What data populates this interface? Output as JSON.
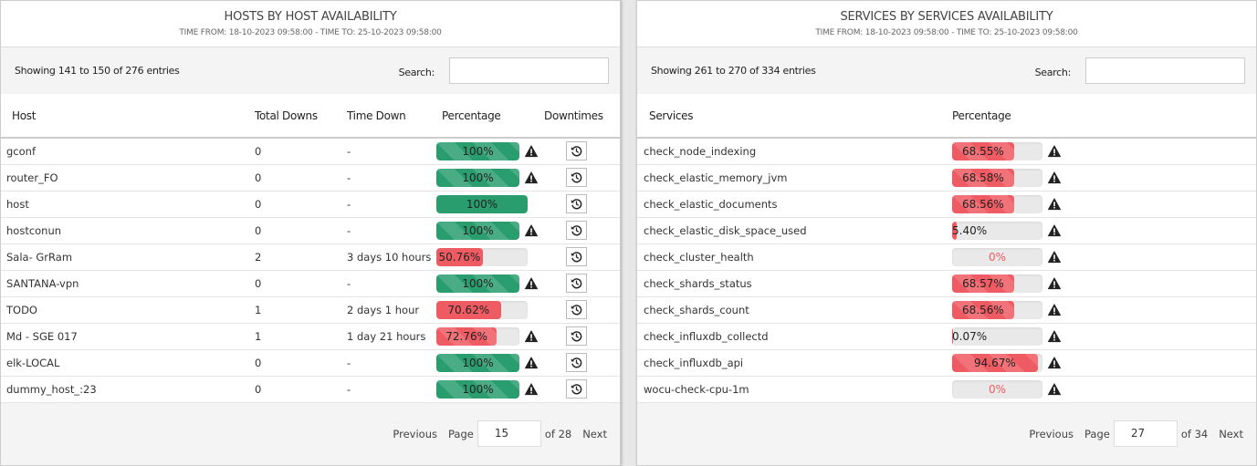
{
  "hosts_panel": {
    "title": "HOSTS BY HOST AVAILABILITY",
    "subtitle": "TIME FROM: 18-10-2023 09:58:00 - TIME TO: 25-10-2023 09:58:00",
    "info": "Showing 141 to 150 of 276 entries",
    "search_label": "Search:",
    "search_value": "",
    "columns": [
      "Host",
      "Total Downs",
      "Time Down",
      "Percentage",
      "Downtimes"
    ],
    "rows": [
      {
        "host": "gconf",
        "total_downs": "0",
        "time_down": "-",
        "percentage": 100,
        "label": "100%",
        "color": "green",
        "striped": true,
        "warning": true
      },
      {
        "host": "router_FO",
        "total_downs": "0",
        "time_down": "-",
        "percentage": 100,
        "label": "100%",
        "color": "green",
        "striped": true,
        "warning": true
      },
      {
        "host": "host",
        "total_downs": "0",
        "time_down": "-",
        "percentage": 100,
        "label": "100%",
        "color": "green",
        "striped": false,
        "warning": false
      },
      {
        "host": "hostconun",
        "total_downs": "0",
        "time_down": "-",
        "percentage": 100,
        "label": "100%",
        "color": "green",
        "striped": true,
        "warning": true
      },
      {
        "host": "Sala- GrRam",
        "total_downs": "2",
        "time_down": "3 days 10 hours",
        "percentage": 50.76,
        "label": "50.76%",
        "color": "red",
        "striped": false,
        "warning": false
      },
      {
        "host": "SANTANA-vpn",
        "total_downs": "0",
        "time_down": "-",
        "percentage": 100,
        "label": "100%",
        "color": "green",
        "striped": true,
        "warning": true
      },
      {
        "host": "TODO",
        "total_downs": "1",
        "time_down": "2 days 1 hour",
        "percentage": 70.62,
        "label": "70.62%",
        "color": "red",
        "striped": false,
        "warning": false
      },
      {
        "host": "Md - SGE 017",
        "total_downs": "1",
        "time_down": "1 day 21 hours",
        "percentage": 72.76,
        "label": "72.76%",
        "color": "red",
        "striped": true,
        "warning": true
      },
      {
        "host": "elk-LOCAL",
        "total_downs": "0",
        "time_down": "-",
        "percentage": 100,
        "label": "100%",
        "color": "green",
        "striped": true,
        "warning": true
      },
      {
        "host": "dummy_host_:23",
        "total_downs": "0",
        "time_down": "-",
        "percentage": 100,
        "label": "100%",
        "color": "green",
        "striped": true,
        "warning": true
      }
    ],
    "pagination": {
      "previous": "Previous",
      "page_label": "Page",
      "page": "15",
      "of": "of 28",
      "next": "Next"
    }
  },
  "services_panel": {
    "title": "SERVICES BY SERVICES AVAILABILITY",
    "subtitle": "TIME FROM: 18-10-2023 09:58:00 - TIME TO: 25-10-2023 09:58:00",
    "info": "Showing 261 to 270 of 334 entries",
    "search_label": "Search:",
    "search_value": "",
    "columns": [
      "Services",
      "Percentage"
    ],
    "rows": [
      {
        "service": "check_node_indexing",
        "percentage": 68.55,
        "label": "68.55%",
        "warning": true
      },
      {
        "service": "check_elastic_memory_jvm",
        "percentage": 68.58,
        "label": "68.58%",
        "warning": true
      },
      {
        "service": "check_elastic_documents",
        "percentage": 68.56,
        "label": "68.56%",
        "warning": true
      },
      {
        "service": "check_elastic_disk_space_used",
        "percentage": 5.4,
        "label": "5.40%",
        "warning": true
      },
      {
        "service": "check_cluster_health",
        "percentage": 0,
        "label": "0%",
        "warning": true
      },
      {
        "service": "check_shards_status",
        "percentage": 68.57,
        "label": "68.57%",
        "warning": true
      },
      {
        "service": "check_shards_count",
        "percentage": 68.56,
        "label": "68.56%",
        "warning": true
      },
      {
        "service": "check_influxdb_collectd",
        "percentage": 0.07,
        "label": "0.07%",
        "warning": true
      },
      {
        "service": "check_influxdb_api",
        "percentage": 94.67,
        "label": "94.67%",
        "warning": true
      },
      {
        "service": "wocu-check-cpu-1m",
        "percentage": 0,
        "label": "0%",
        "warning": true
      }
    ],
    "pagination": {
      "previous": "Previous",
      "page_label": "Page",
      "page": "27",
      "of": "of 34",
      "next": "Next"
    }
  },
  "colors": {
    "ok": "#2a9d6e",
    "bad": "#ef5b62",
    "track": "#e9e9e9"
  }
}
